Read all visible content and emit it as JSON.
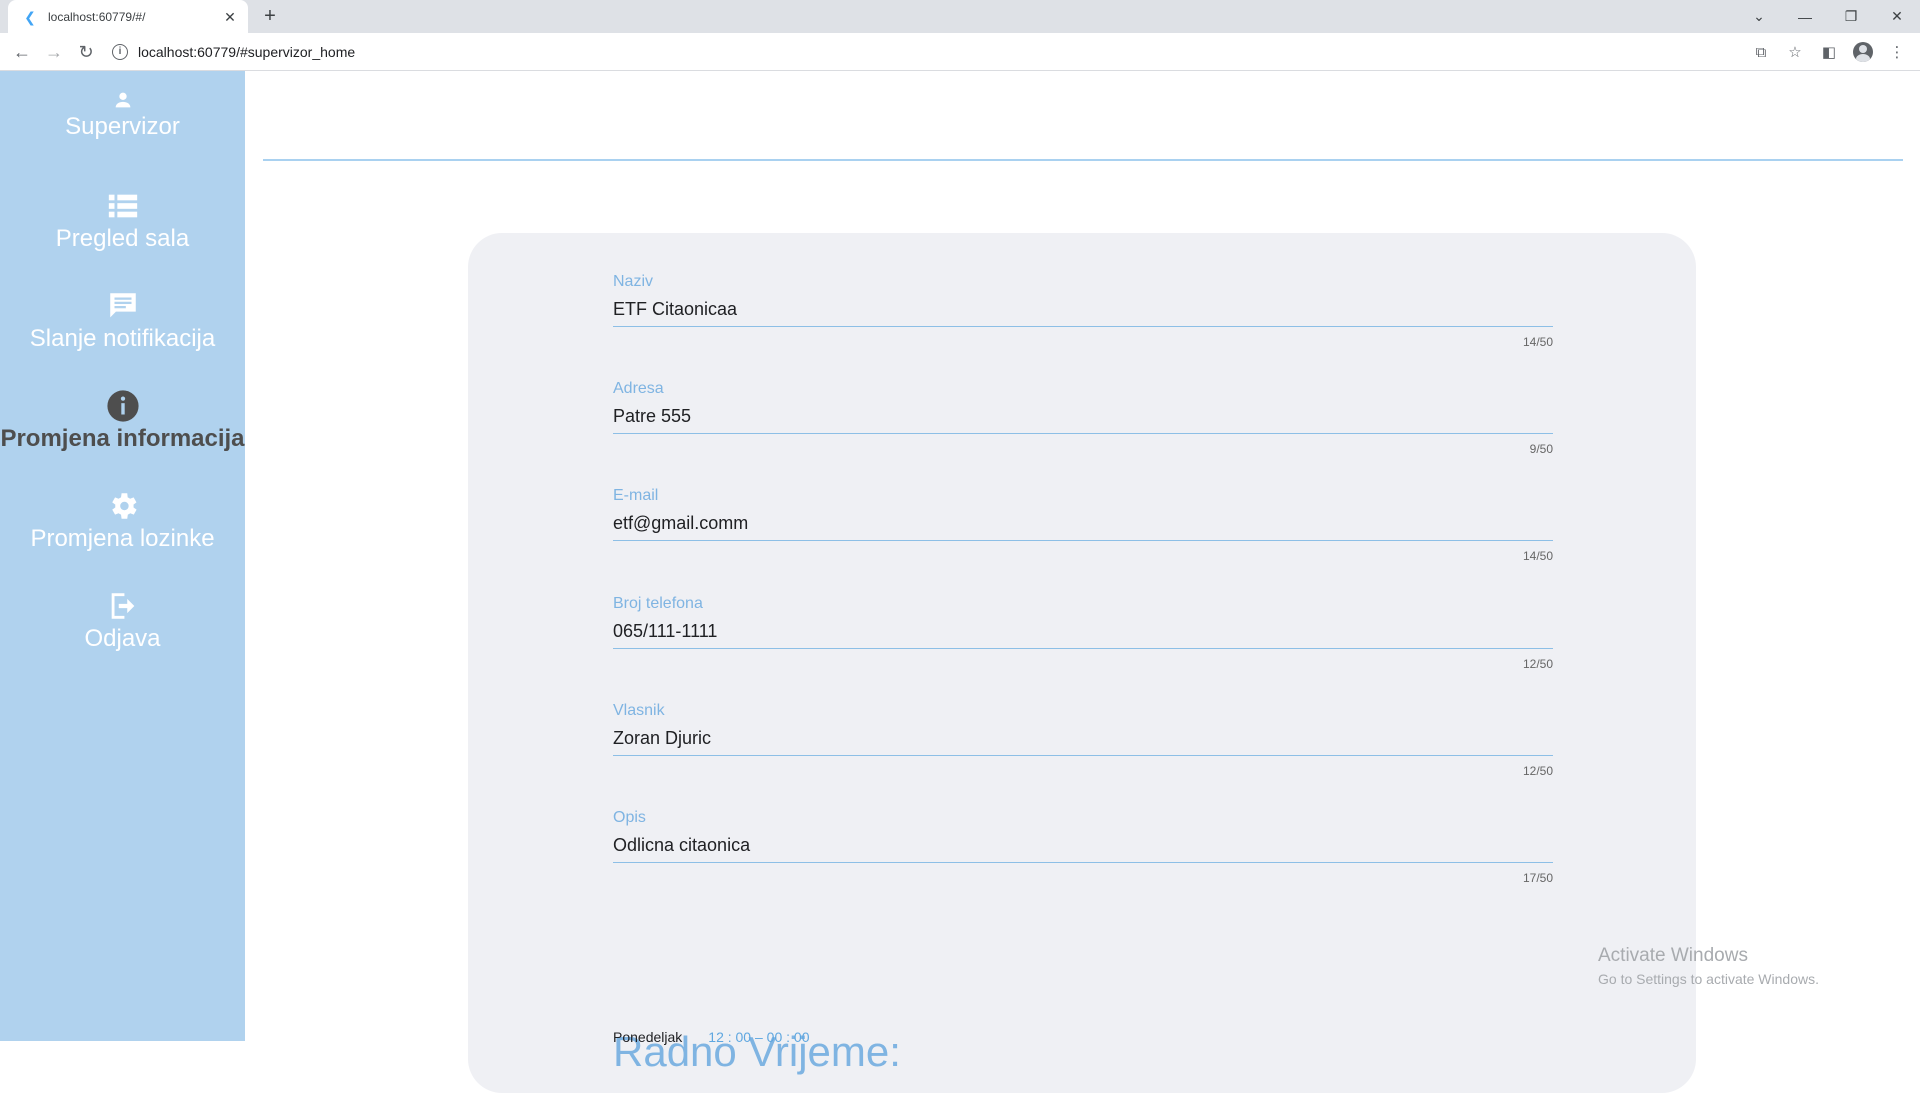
{
  "browser": {
    "tab_title": "localhost:60779/#/",
    "url": "localhost:60779/#supervizor_home",
    "favicon": "flutter-icon"
  },
  "sidebar": {
    "bg_color": "#b0d2ee",
    "items": [
      {
        "label": "Supervizor",
        "icon": "person-icon",
        "active": false
      },
      {
        "label": "Pregled sala",
        "icon": "list-icon",
        "active": false
      },
      {
        "label": "Slanje notifikacija",
        "icon": "chat-icon",
        "active": false
      },
      {
        "label": "Promjena informacija",
        "icon": "info-icon",
        "active": true
      },
      {
        "label": "Promjena lozinke",
        "icon": "gear-icon",
        "active": false
      },
      {
        "label": "Odjava",
        "icon": "logout-icon",
        "active": false
      }
    ]
  },
  "form": {
    "fields": [
      {
        "label": "Naziv",
        "value": "ETF Citaonicaa",
        "counter": "14/50"
      },
      {
        "label": "Adresa",
        "value": "Patre 555",
        "counter": "9/50"
      },
      {
        "label": "E-mail",
        "value": "etf@gmail.comm",
        "counter": "14/50"
      },
      {
        "label": "Broj telefona",
        "value": "065/111-1111",
        "counter": "12/50"
      },
      {
        "label": "Vlasnik",
        "value": "Zoran Djuric",
        "counter": "12/50"
      },
      {
        "label": "Opis",
        "value": "Odlicna citaonica",
        "counter": "17/50"
      }
    ],
    "working_hours": {
      "title": "Radno Vrijeme:",
      "first_day": "Ponedeljak",
      "first_time": "12 : 00  –  00 : 00"
    }
  },
  "watermark": {
    "line1": "Activate Windows",
    "line2": "Go to Settings to activate Windows."
  }
}
